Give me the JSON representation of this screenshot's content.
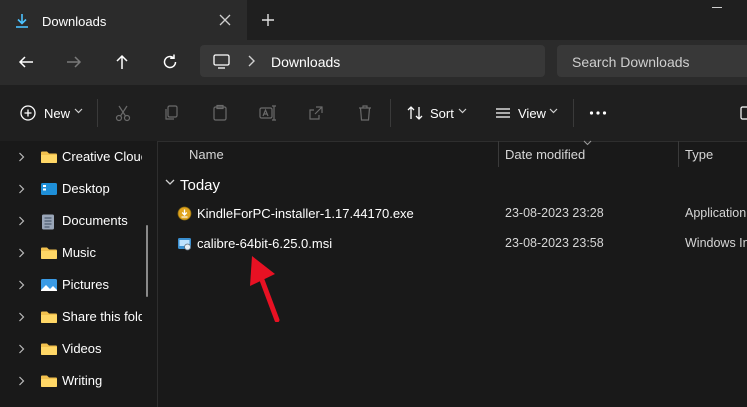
{
  "window": {
    "tab_title": "Downloads"
  },
  "nav": {
    "back_icon": "arrow-left-icon",
    "forward_icon": "arrow-right-icon",
    "up_icon": "arrow-up-icon",
    "refresh_icon": "refresh-icon"
  },
  "address": {
    "crumb": "Downloads"
  },
  "search": {
    "placeholder": "Search Downloads"
  },
  "toolbar": {
    "new_label": "New",
    "sort_label": "Sort",
    "view_label": "View"
  },
  "sidebar": {
    "items": [
      {
        "label": "Creative Clouc",
        "icon": "folder-icon"
      },
      {
        "label": "Desktop",
        "icon": "desktop-icon"
      },
      {
        "label": "Documents",
        "icon": "documents-icon"
      },
      {
        "label": "Music",
        "icon": "folder-icon"
      },
      {
        "label": "Pictures",
        "icon": "pictures-icon"
      },
      {
        "label": "Share this fold",
        "icon": "folder-icon"
      },
      {
        "label": "Videos",
        "icon": "folder-icon"
      },
      {
        "label": "Writing",
        "icon": "folder-icon"
      }
    ]
  },
  "list": {
    "columns": {
      "name": "Name",
      "date": "Date modified",
      "type": "Type"
    },
    "group": "Today",
    "files": [
      {
        "name": "KindleForPC-installer-1.17.44170.exe",
        "date": "23-08-2023 23:28",
        "type": "Application"
      },
      {
        "name": "calibre-64bit-6.25.0.msi",
        "date": "23-08-2023 23:58",
        "type": "Windows In"
      }
    ]
  },
  "colors": {
    "accent": "#4cc2ff",
    "annotation_arrow": "#e81123",
    "folder": "#f2c14e"
  }
}
